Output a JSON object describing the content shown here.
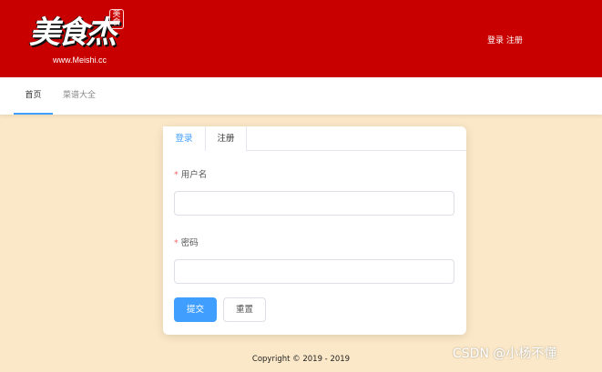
{
  "header": {
    "logo": {
      "brand": "美食杰",
      "seal": "美食",
      "url": "www.Meishi.cc"
    },
    "auth": {
      "login": "登录",
      "register": "注册"
    },
    "background_color": "#c90000"
  },
  "nav": {
    "items": [
      {
        "label": "首页",
        "active": true
      },
      {
        "label": "菜谱大全",
        "active": false
      }
    ],
    "active_color": "#409eff"
  },
  "form": {
    "tabs": [
      {
        "label": "登录",
        "active": true
      },
      {
        "label": "注册",
        "active": false
      }
    ],
    "fields": [
      {
        "label": "用户名",
        "required_mark": "*",
        "value": "",
        "placeholder": ""
      },
      {
        "label": "密码",
        "required_mark": "*",
        "value": "",
        "placeholder": ""
      }
    ],
    "buttons": {
      "submit": "提交",
      "reset": "重置"
    }
  },
  "footer": {
    "copyright": "Copyright © 2019 - 2019"
  },
  "watermark": "CSDN @小杨不懂",
  "page_background": "#fbe8c8"
}
